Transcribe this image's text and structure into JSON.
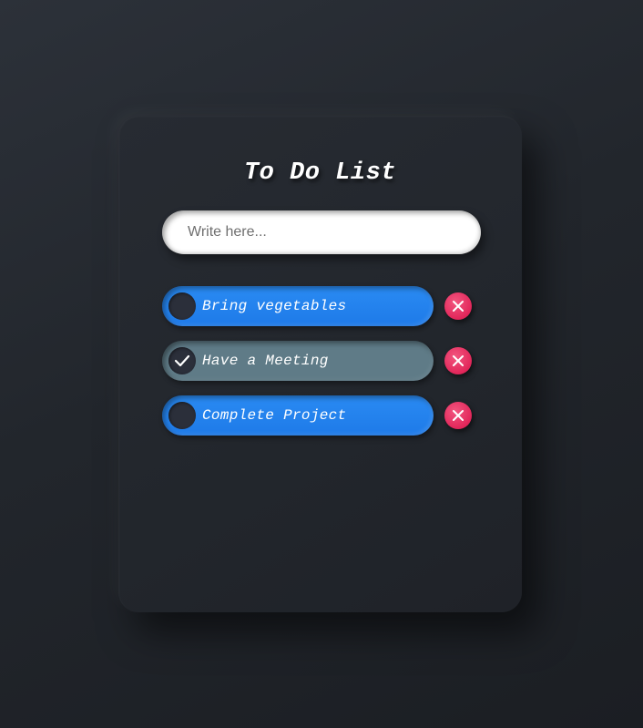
{
  "app": {
    "title": "To Do List"
  },
  "input": {
    "placeholder": "Write here...",
    "value": ""
  },
  "tasks": [
    {
      "label": "Bring vegetables",
      "completed": false
    },
    {
      "label": "Have a Meeting",
      "completed": true
    },
    {
      "label": "Complete Project",
      "completed": false
    }
  ],
  "icons": {
    "check": "check-icon",
    "delete": "close-icon"
  },
  "colors": {
    "active_task": "#1e7ae8",
    "completed_task": "#5f7b87",
    "delete_button": "#e2265a",
    "card_background": "#22262c"
  }
}
